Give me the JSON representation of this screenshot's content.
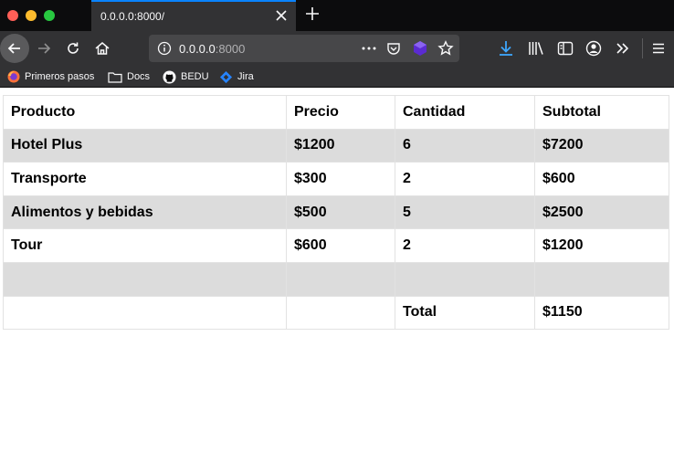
{
  "browser": {
    "tab_title": "0.0.0.0:8000/",
    "url_host": "0.0.0.0",
    "url_port": ":8000",
    "accent": "#0a84ff",
    "bookmarks": [
      {
        "label": "Primeros pasos",
        "icon": "firefox-icon"
      },
      {
        "label": "Docs",
        "icon": "folder-icon"
      },
      {
        "label": "BEDU",
        "icon": "github-icon"
      },
      {
        "label": "Jira",
        "icon": "jira-icon"
      }
    ]
  },
  "table": {
    "headers": [
      "Producto",
      "Precio",
      "Cantidad",
      "Subtotal"
    ],
    "rows": [
      {
        "producto": "Hotel Plus",
        "precio": "$1200",
        "cantidad": "6",
        "subtotal": "$7200"
      },
      {
        "producto": "Transporte",
        "precio": "$300",
        "cantidad": "2",
        "subtotal": "$600"
      },
      {
        "producto": "Alimentos y bebidas",
        "precio": "$500",
        "cantidad": "5",
        "subtotal": "$2500"
      },
      {
        "producto": "Tour",
        "precio": "$600",
        "cantidad": "2",
        "subtotal": "$1200"
      }
    ],
    "total_label": "Total",
    "total_value": "$1150"
  }
}
